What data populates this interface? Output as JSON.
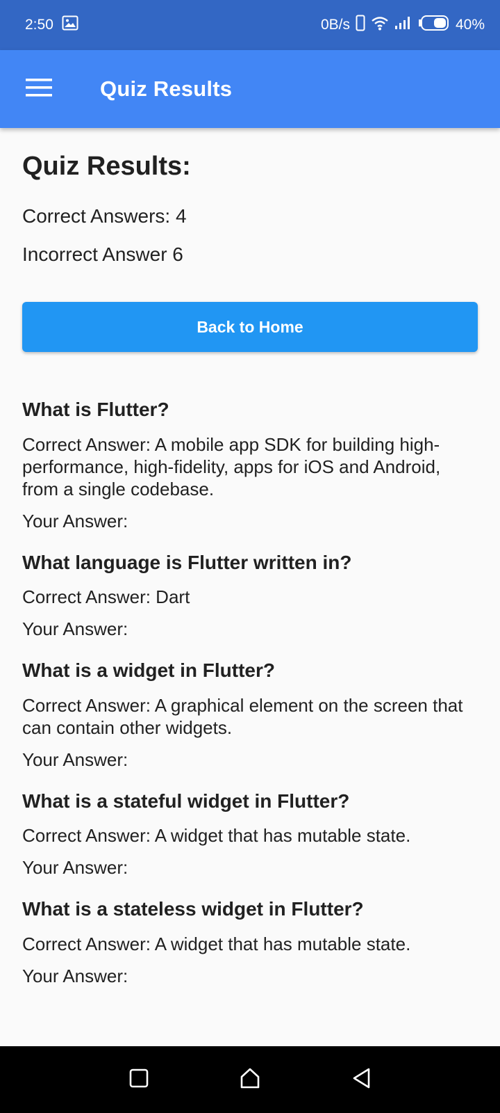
{
  "status_bar": {
    "time": "2:50",
    "network_speed": "0B/s",
    "battery": "40%",
    "icons": [
      "image-icon",
      "phone-icon",
      "wifi-icon",
      "signal-icon",
      "battery-icon"
    ]
  },
  "app_bar": {
    "title": "Quiz Results",
    "menu_icon": "hamburger-menu-icon",
    "background": "#4286f5"
  },
  "summary": {
    "heading": "Quiz Results:",
    "correct": "Correct Answers: 4",
    "incorrect": "Incorrect Answer 6"
  },
  "back_button": {
    "label": "Back to Home",
    "color": "#2196f3"
  },
  "results": [
    {
      "question": "What is Flutter?",
      "correct": "Correct Answer: A mobile app SDK for building high-performance, high-fidelity, apps for iOS and Android, from a single codebase.",
      "yours": "Your Answer:"
    },
    {
      "question": "What language is Flutter written in?",
      "correct": "Correct Answer: Dart",
      "yours": "Your Answer:"
    },
    {
      "question": "What is a widget in Flutter?",
      "correct": "Correct Answer: A graphical element on the screen that can contain other widgets.",
      "yours": "Your Answer:"
    },
    {
      "question": "What is a stateful widget in Flutter?",
      "correct": "Correct Answer: A widget that has mutable state.",
      "yours": "Your Answer:"
    },
    {
      "question": "What is a stateless widget in Flutter?",
      "correct": "Correct Answer: A widget that has mutable state.",
      "yours": "Your Answer:"
    }
  ],
  "nav_bar": {
    "icons": [
      "recents-square-icon",
      "home-icon",
      "back-triangle-icon"
    ]
  }
}
